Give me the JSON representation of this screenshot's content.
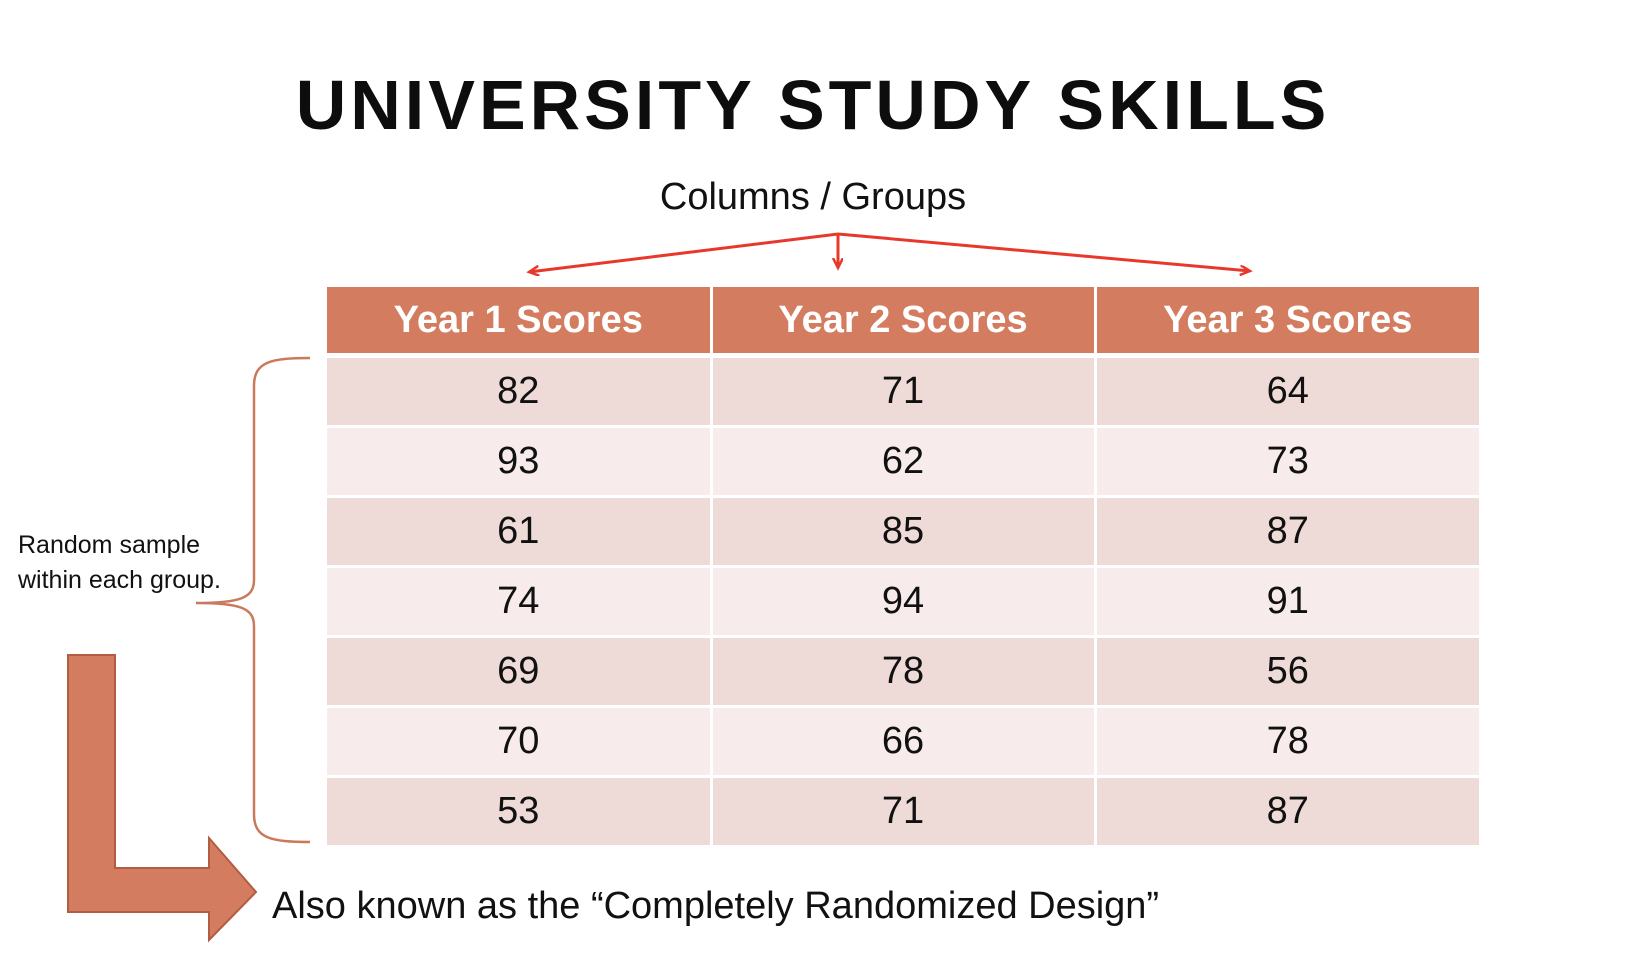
{
  "slide": {
    "title": "UNIVERSITY STUDY SKILLS",
    "columns_label": "Columns / Groups",
    "sample_label": "Random sample within each group.",
    "footnote": "Also known as the “Completely Randomized Design”"
  },
  "table": {
    "headers": [
      "Year 1 Scores",
      "Year 2 Scores",
      "Year 3 Scores"
    ],
    "rows": [
      [
        "82",
        "71",
        "64"
      ],
      [
        "93",
        "62",
        "73"
      ],
      [
        "61",
        "85",
        "87"
      ],
      [
        "74",
        "94",
        "91"
      ],
      [
        "69",
        "78",
        "56"
      ],
      [
        "70",
        "66",
        "78"
      ],
      [
        "53",
        "71",
        "87"
      ]
    ]
  },
  "colors": {
    "header_fill": "#d47c5f",
    "row_odd": "#eedbd7",
    "row_even": "#f7eceb",
    "arrow_red": "#e8382c",
    "brace_stroke": "#c97a5c",
    "l_arrow_fill": "#d47c5f",
    "l_arrow_stroke": "#b35c42"
  },
  "icons": {
    "columns_arrows": "red-arrows-icon",
    "brace": "curly-brace-icon",
    "bent_arrow": "bent-arrow-icon"
  }
}
